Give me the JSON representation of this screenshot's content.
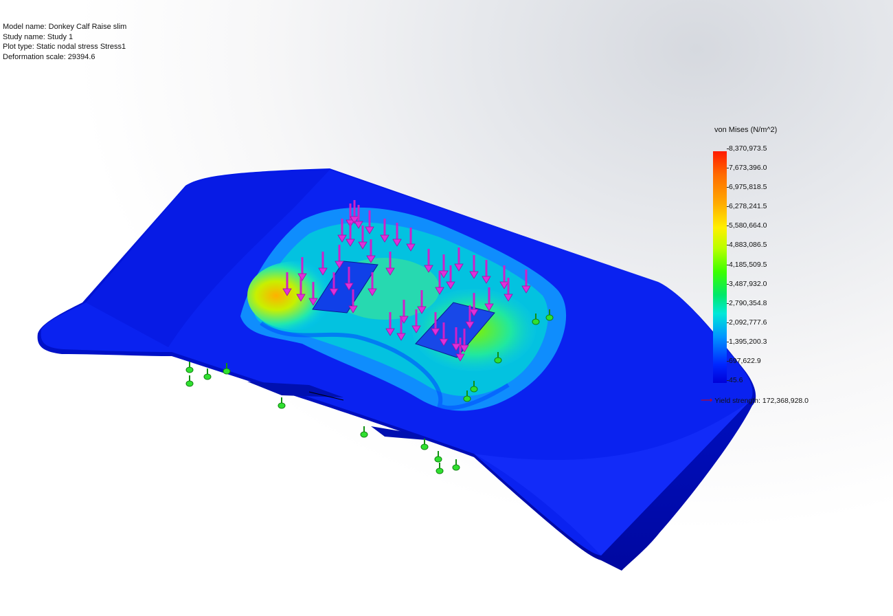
{
  "info": {
    "model_name": "Model name: Donkey Calf Raise slim",
    "study_name": "Study name: Study 1",
    "plot_type": "Plot type: Static nodal stress Stress1",
    "deformation_scale": "Deformation scale: 29394.6"
  },
  "legend": {
    "title": "von Mises (N/m^2)",
    "ticks": [
      "8,370,973.5",
      "7,673,396.0",
      "6,975,818.5",
      "6,278,241.5",
      "5,580,664.0",
      "4,883,086.5",
      "4,185,509.5",
      "3,487,932.0",
      "2,790,354.8",
      "2,092,777.6",
      "1,395,200.3",
      "697,622.9",
      "45.6"
    ],
    "yield_label": "Yield strength: 172,368,928.0",
    "yield_arrow_icon": "red-arrow-icon"
  },
  "colors": {
    "max": "#ff1a00",
    "min": "#0000d8",
    "part_base": "#0c1ee8",
    "load_arrow": "#e020d0",
    "fixture": "#20d020"
  }
}
